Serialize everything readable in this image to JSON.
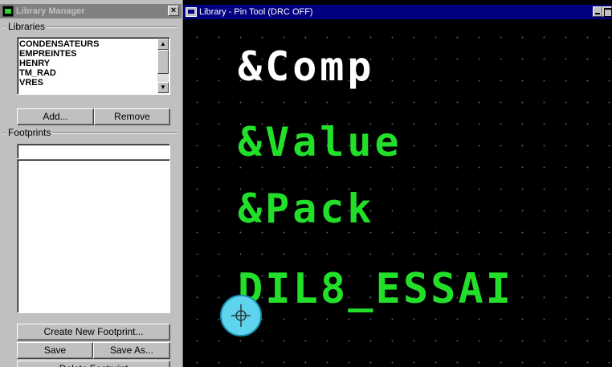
{
  "library_manager": {
    "title": "Library Manager",
    "close_glyph": "×",
    "libraries_label": "Libraries",
    "libraries": [
      "CONDENSATEURS",
      "EMPREINTES",
      "HENRY",
      "TM_RAD",
      "VRES"
    ],
    "add_button": "Add...",
    "remove_button": "Remove",
    "footprints_label": "Footprints",
    "footprint_search_value": "",
    "create_button": "Create New Footprint...",
    "save_button": "Save",
    "save_as_button": "Save As...",
    "delete_button": "Delete Footprint"
  },
  "pin_tool": {
    "title": "Library - Pin Tool (DRC OFF)",
    "comp_text": "&Comp",
    "value_text": "&Value",
    "pack_text": "&Pack",
    "footprint_name": "DIL8_ESSAI"
  },
  "colors": {
    "background": "#000000",
    "grid_dot": "#5a5a5a",
    "comp_text": "#ffffff",
    "green_text": "#22e02a",
    "pin_fill": "#5fd4ee",
    "title_active": "#000080",
    "title_inactive": "#808080"
  },
  "icons": {
    "pin_cursor": "pin-crosshair-icon",
    "scroll_up": "arrow-up-icon",
    "scroll_down": "arrow-down-icon"
  }
}
